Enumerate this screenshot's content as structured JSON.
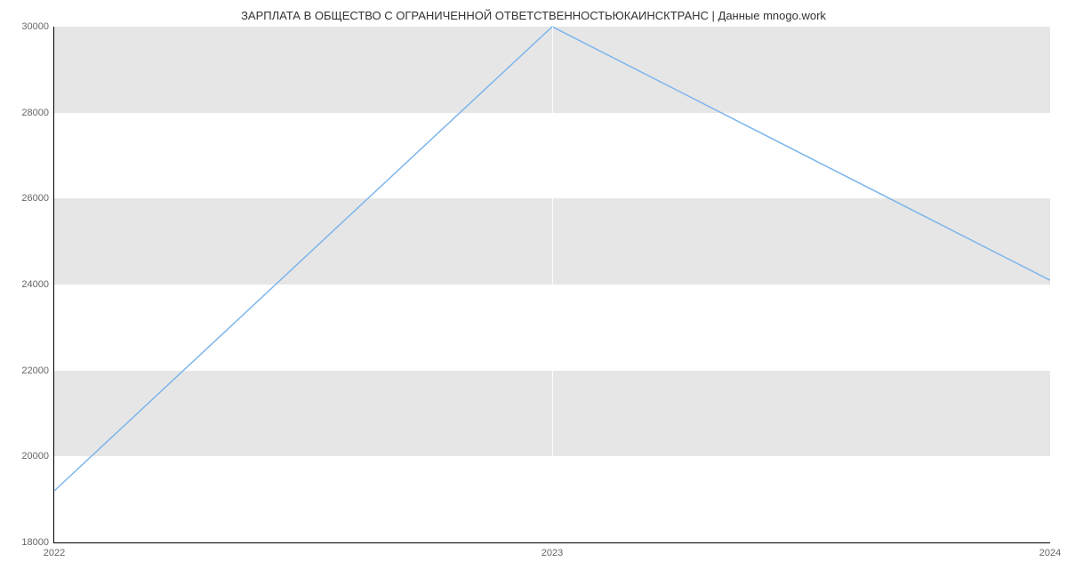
{
  "chart_data": {
    "type": "line",
    "title": "ЗАРПЛАТА В ОБЩЕСТВО  С ОГРАНИЧЕННОЙ ОТВЕТСТВЕННОСТЬЮКАИНСКТРАНС | Данные mnogo.work",
    "x": [
      2022,
      2023,
      2024
    ],
    "values": [
      19200,
      30000,
      24100
    ],
    "xlabel": "",
    "ylabel": "",
    "y_ticks": [
      18000,
      20000,
      22000,
      24000,
      26000,
      28000,
      30000
    ],
    "x_ticks": [
      2022,
      2023,
      2024
    ],
    "ylim": [
      18000,
      30000
    ],
    "xlim": [
      2022,
      2024
    ],
    "line_color": "#7cb5ec"
  }
}
